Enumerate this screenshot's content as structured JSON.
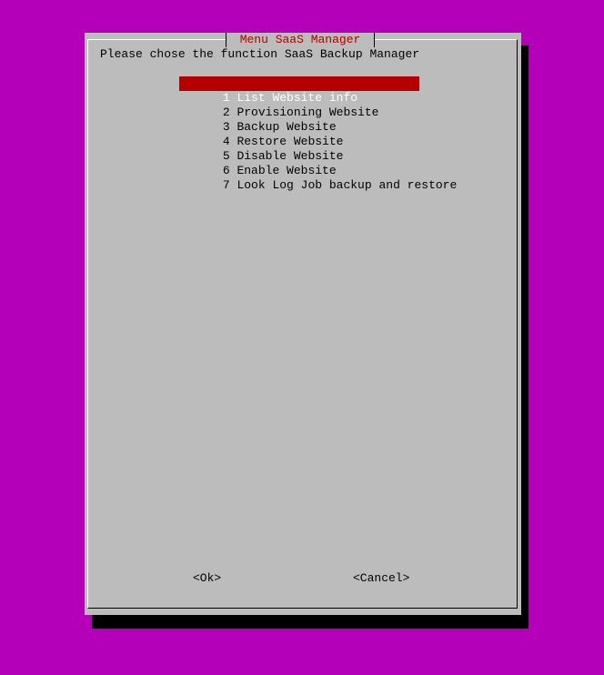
{
  "colors": {
    "background": "#b400b8",
    "dialog": "#bcbcbc",
    "title_text": "#b30000",
    "selection": "#b50000"
  },
  "dialog": {
    "title": "Menu SaaS Manager",
    "prompt": "Please chose the function SaaS Backup Manager",
    "menu": {
      "selected_index": 0,
      "items": [
        {
          "tag": "1",
          "label": "List Website info"
        },
        {
          "tag": "2",
          "label": "Provisioning Website"
        },
        {
          "tag": "3",
          "label": "Backup Website"
        },
        {
          "tag": "4",
          "label": "Restore Website"
        },
        {
          "tag": "5",
          "label": "Disable Website"
        },
        {
          "tag": "6",
          "label": "Enable Website"
        },
        {
          "tag": "7",
          "label": "Look Log Job backup and restore"
        }
      ]
    },
    "buttons": {
      "ok": "<Ok>",
      "cancel": "<Cancel>"
    }
  }
}
